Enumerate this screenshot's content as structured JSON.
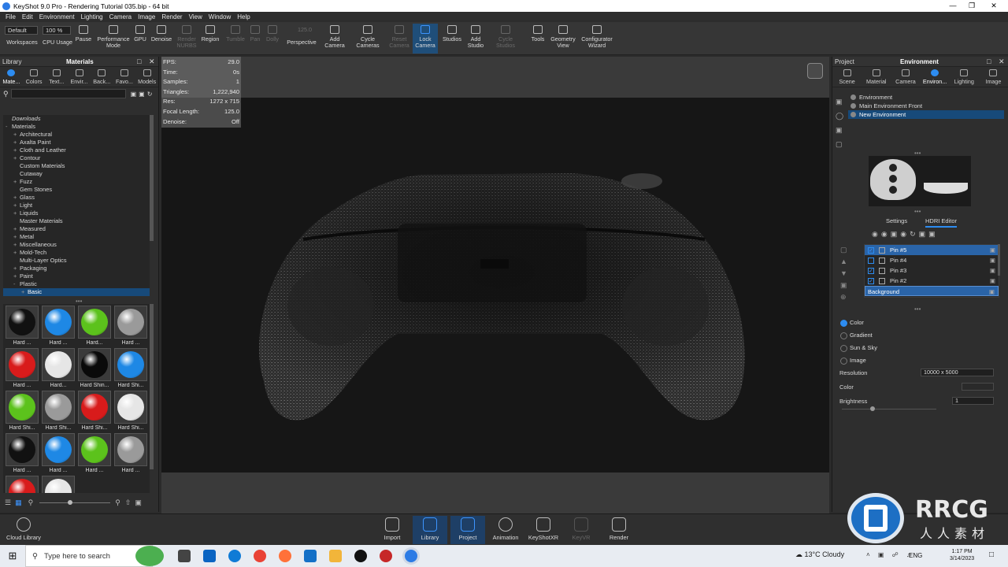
{
  "window": {
    "title": "KeyShot 9.0 Pro  -  Rendering Tutorial 035.bip  -  64 bit"
  },
  "menu": [
    "File",
    "Edit",
    "Environment",
    "Lighting",
    "Camera",
    "Image",
    "Render",
    "View",
    "Window",
    "Help"
  ],
  "toolbar": {
    "workspace_value": "Default",
    "cpu_value": "100 %",
    "focal_value": "125.0",
    "buttons": [
      {
        "label": "Workspaces",
        "enabled": true
      },
      {
        "label": "CPU Usage",
        "enabled": true
      },
      {
        "label": "Pause",
        "enabled": true
      },
      {
        "label": "Performance Mode",
        "enabled": true
      },
      {
        "label": "GPU",
        "enabled": true
      },
      {
        "label": "Denoise",
        "enabled": true
      },
      {
        "label": "Render NURBS",
        "enabled": false
      },
      {
        "label": "Region",
        "enabled": true
      },
      {
        "label": "Tumble",
        "enabled": false
      },
      {
        "label": "Pan",
        "enabled": false
      },
      {
        "label": "Dolly",
        "enabled": false
      },
      {
        "label": "Perspective",
        "enabled": true
      },
      {
        "label": "Add Camera",
        "enabled": true
      },
      {
        "label": "Cycle Cameras",
        "enabled": true
      },
      {
        "label": "Reset Camera",
        "enabled": false
      },
      {
        "label": "Lock Camera",
        "enabled": true,
        "active": true
      },
      {
        "label": "Studios",
        "enabled": true
      },
      {
        "label": "Add Studio",
        "enabled": true
      },
      {
        "label": "Cycle Studios",
        "enabled": false
      },
      {
        "label": "Tools",
        "enabled": true
      },
      {
        "label": "Geometry View",
        "enabled": true
      },
      {
        "label": "Configurator Wizard",
        "enabled": true
      }
    ]
  },
  "library": {
    "header_left": "Library",
    "header_title": "Materials",
    "tabs": [
      "Mate...",
      "Colors",
      "Text...",
      "Envir...",
      "Back...",
      "Favo...",
      "Models"
    ],
    "tree": [
      {
        "label": "Downloads",
        "level": 0,
        "italic": true
      },
      {
        "label": "Materials",
        "level": 0,
        "expander": "-"
      },
      {
        "label": "Architectural",
        "level": 1,
        "expander": "+"
      },
      {
        "label": "Axalta Paint",
        "level": 1,
        "expander": "+"
      },
      {
        "label": "Cloth and Leather",
        "level": 1,
        "expander": "+"
      },
      {
        "label": "Contour",
        "level": 1,
        "expander": "+"
      },
      {
        "label": "Custom Materials",
        "level": 1
      },
      {
        "label": "Cutaway",
        "level": 1
      },
      {
        "label": "Fuzz",
        "level": 1,
        "expander": "+"
      },
      {
        "label": "Gem Stones",
        "level": 1
      },
      {
        "label": "Glass",
        "level": 1,
        "expander": "+"
      },
      {
        "label": "Light",
        "level": 1,
        "expander": "+"
      },
      {
        "label": "Liquids",
        "level": 1,
        "expander": "+"
      },
      {
        "label": "Master Materials",
        "level": 1
      },
      {
        "label": "Measured",
        "level": 1,
        "expander": "+"
      },
      {
        "label": "Metal",
        "level": 1,
        "expander": "+"
      },
      {
        "label": "Miscellaneous",
        "level": 1,
        "expander": "+"
      },
      {
        "label": "Mold-Tech",
        "level": 1,
        "expander": "+"
      },
      {
        "label": "Multi-Layer Optics",
        "level": 1
      },
      {
        "label": "Packaging",
        "level": 1,
        "expander": "+"
      },
      {
        "label": "Paint",
        "level": 1,
        "expander": "+"
      },
      {
        "label": "Plastic",
        "level": 1,
        "expander": "-"
      },
      {
        "label": "Basic",
        "level": 2,
        "expander": "+",
        "selected": true
      }
    ],
    "thumbnails": [
      {
        "label": "Hard ...",
        "color": "#111111"
      },
      {
        "label": "Hard ...",
        "color": "#1e88e5"
      },
      {
        "label": "Hard...",
        "color": "#5cc21c"
      },
      {
        "label": "Hard ...",
        "color": "#9a9a9a"
      },
      {
        "label": "Hard ...",
        "color": "#d81b1b"
      },
      {
        "label": "Hard...",
        "color": "#e6e6e6"
      },
      {
        "label": "Hard Shin...",
        "color": "#0a0a0a"
      },
      {
        "label": "Hard Shi...",
        "color": "#1e88e5"
      },
      {
        "label": "Hard Shi...",
        "color": "#5cc21c"
      },
      {
        "label": "Hard Shi...",
        "color": "#9a9a9a"
      },
      {
        "label": "Hard Shi...",
        "color": "#d81b1b"
      },
      {
        "label": "Hard Shi...",
        "color": "#e6e6e6"
      },
      {
        "label": "Hard ...",
        "color": "#111111"
      },
      {
        "label": "Hard ...",
        "color": "#1e88e5"
      },
      {
        "label": "Hard ...",
        "color": "#5cc21c"
      },
      {
        "label": "Hard ...",
        "color": "#9a9a9a"
      },
      {
        "label": "",
        "color": "#d81b1b"
      },
      {
        "label": "",
        "color": "#e6e6e6"
      }
    ]
  },
  "stats": [
    {
      "k": "FPS:",
      "v": "29.0"
    },
    {
      "k": "Time:",
      "v": "0s"
    },
    {
      "k": "Samples:",
      "v": "1"
    },
    {
      "k": "Triangles:",
      "v": "1,222,940"
    },
    {
      "k": "Res:",
      "v": "1272 x 715"
    },
    {
      "k": "Focal Length:",
      "v": "125.0"
    },
    {
      "k": "Denoise:",
      "v": "Off"
    }
  ],
  "project": {
    "header_left": "Project",
    "header_title": "Environment",
    "tabs": [
      "Scene",
      "Material",
      "Camera",
      "Environ...",
      "Lighting",
      "Image"
    ],
    "environments": [
      {
        "label": "Environment",
        "selected": false
      },
      {
        "label": "Main Environment Front",
        "selected": false
      },
      {
        "label": "New Environment",
        "selected": true
      }
    ],
    "subtabs": [
      "Settings",
      "HDRI Editor"
    ],
    "pins": [
      {
        "label": "Pin #5",
        "checked": true,
        "selected": true
      },
      {
        "label": "Pin #4",
        "checked": false,
        "selected": false
      },
      {
        "label": "Pin #3",
        "checked": true,
        "selected": false
      },
      {
        "label": "Pin #2",
        "checked": true,
        "selected": false
      },
      {
        "label": "Background",
        "checked": false,
        "selected": true,
        "background": true
      }
    ],
    "bg_options": [
      {
        "label": "Color",
        "on": true
      },
      {
        "label": "Gradient",
        "on": false
      },
      {
        "label": "Sun & Sky",
        "on": false
      },
      {
        "label": "Image",
        "on": false
      }
    ],
    "resolution_label": "Resolution",
    "resolution_value": "10000 x 5000",
    "color_label": "Color",
    "brightness_label": "Brightness",
    "brightness_value": "1"
  },
  "bottom": [
    {
      "label": "Cloud Library",
      "enabled": true
    },
    {
      "label": "Import",
      "enabled": true
    },
    {
      "label": "Library",
      "enabled": true,
      "active": true
    },
    {
      "label": "Project",
      "enabled": true,
      "active": true
    },
    {
      "label": "Animation",
      "enabled": true
    },
    {
      "label": "KeyShotXR",
      "enabled": true
    },
    {
      "label": "KeyVR",
      "enabled": false
    },
    {
      "label": "Render",
      "enabled": true
    }
  ],
  "taskbar": {
    "search_placeholder": "Type here to search",
    "weather": "13°C  Cloudy",
    "lang": "ENG",
    "time": "1:17 PM",
    "date": "3/14/2023"
  },
  "watermark": {
    "brand": "RRCG",
    "sub": "人人素材"
  }
}
